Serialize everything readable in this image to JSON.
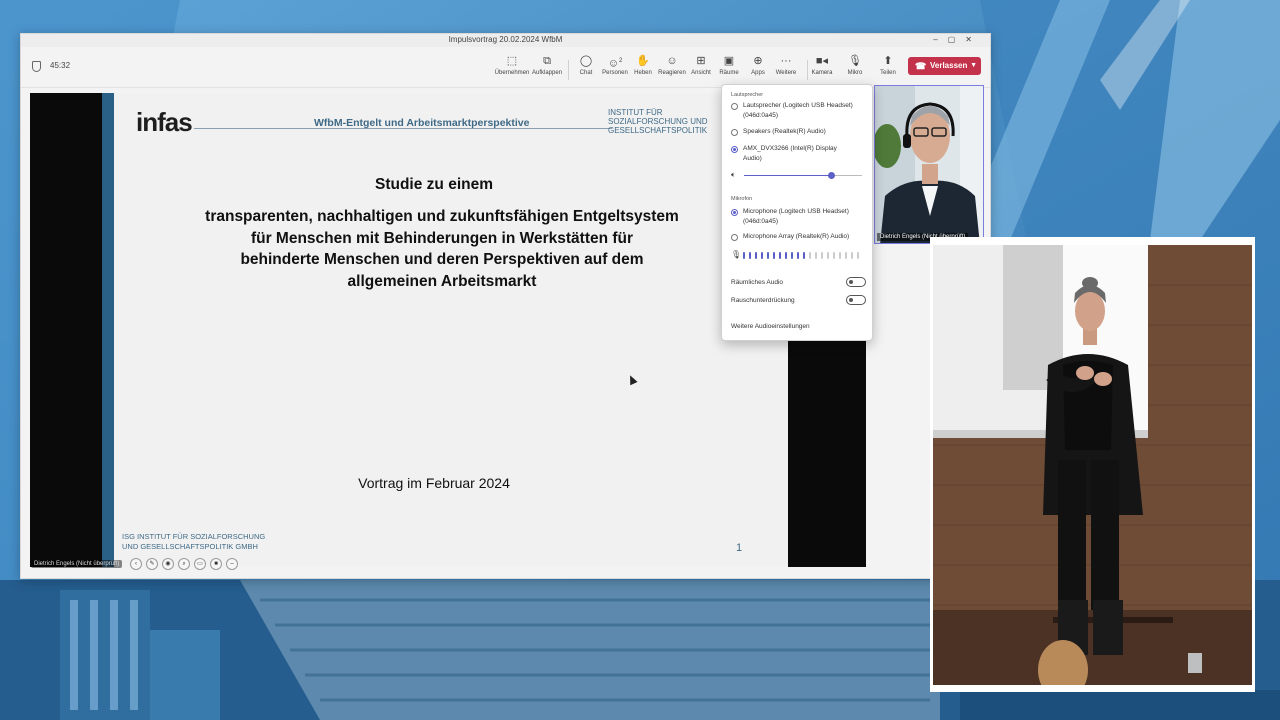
{
  "window": {
    "title": "Impulsvortrag 20.02.2024 WfbM"
  },
  "toolbar": {
    "timer": "45:32",
    "buttons": [
      {
        "label": "Übernehmen",
        "icon": "take-control-icon"
      },
      {
        "label": "Aufklappen",
        "icon": "pop-out-icon"
      },
      {
        "label": "Chat",
        "icon": "chat-icon"
      },
      {
        "label": "Personen",
        "icon": "people-icon",
        "badge": "2"
      },
      {
        "label": "Heben",
        "icon": "raise-hand-icon"
      },
      {
        "label": "Reagieren",
        "icon": "react-icon"
      },
      {
        "label": "Ansicht",
        "icon": "view-icon"
      },
      {
        "label": "Räume",
        "icon": "rooms-icon"
      },
      {
        "label": "Apps",
        "icon": "apps-icon"
      },
      {
        "label": "Weitere",
        "icon": "more-icon"
      },
      {
        "label": "Kamera",
        "icon": "camera-icon"
      },
      {
        "label": "Mikro",
        "icon": "mic-icon"
      },
      {
        "label": "Teilen",
        "icon": "share-icon"
      }
    ],
    "leave_label": "Verlassen",
    "accent": "#c4314b"
  },
  "slide": {
    "logo": "infas",
    "header": "WfbM-Entgelt und Arbeitsmarktperspektive",
    "institute": [
      "INSTITUT FÜR",
      "SOZIALFORSCHUNG UND",
      "GESELLSCHAFTSPOLITIK"
    ],
    "title": "Studie zu einem",
    "subtitle_lines": [
      "transparenten, nachhaltigen und zukunftsfähigen Entgeltsystem",
      "für Menschen mit Behinderungen in Werkstätten für",
      "behinderte Menschen und deren Perspektiven auf dem",
      "allgemeinen Arbeitsmarkt"
    ],
    "date": "Vortrag im Februar 2024",
    "footer_lines": [
      "ISG INSTITUT FÜR SOZIALFORSCHUNG",
      "UND GESELLSCHAFTSPOLITIK GMBH"
    ],
    "page": "1",
    "accent": "#2a5f86"
  },
  "presenter": {
    "label": "Dietrich Engels (Nicht überprüft)"
  },
  "participant": {
    "name": "Dietrich Engels (Nicht überprüft)"
  },
  "audio_panel": {
    "speaker_section": "Lautsprecher",
    "speakers": [
      {
        "label": "Lautsprecher (Logitech USB Headset)",
        "sub": "(046d:0a45)",
        "selected": false
      },
      {
        "label": "Speakers (Realtek(R) Audio)",
        "sub": "",
        "selected": false
      },
      {
        "label": "AMX_DVX3266 (Intel(R) Display",
        "sub": "Audio)",
        "selected": true
      }
    ],
    "volume": 0.74,
    "mic_section": "Mikrofon",
    "mics": [
      {
        "label": "Microphone (Logitech USB Headset)",
        "sub": "(046d:0a45)",
        "selected": true
      },
      {
        "label": "Microphone Array (Realtek(R) Audio)",
        "sub": "",
        "selected": false
      }
    ],
    "mic_level": 0.55,
    "spatial_audio": "Räumliches Audio",
    "noise_suppression": "Rauschunterdrückung",
    "more_settings": "Weitere Audioeinstellungen",
    "accent": "#5b5fc7"
  }
}
